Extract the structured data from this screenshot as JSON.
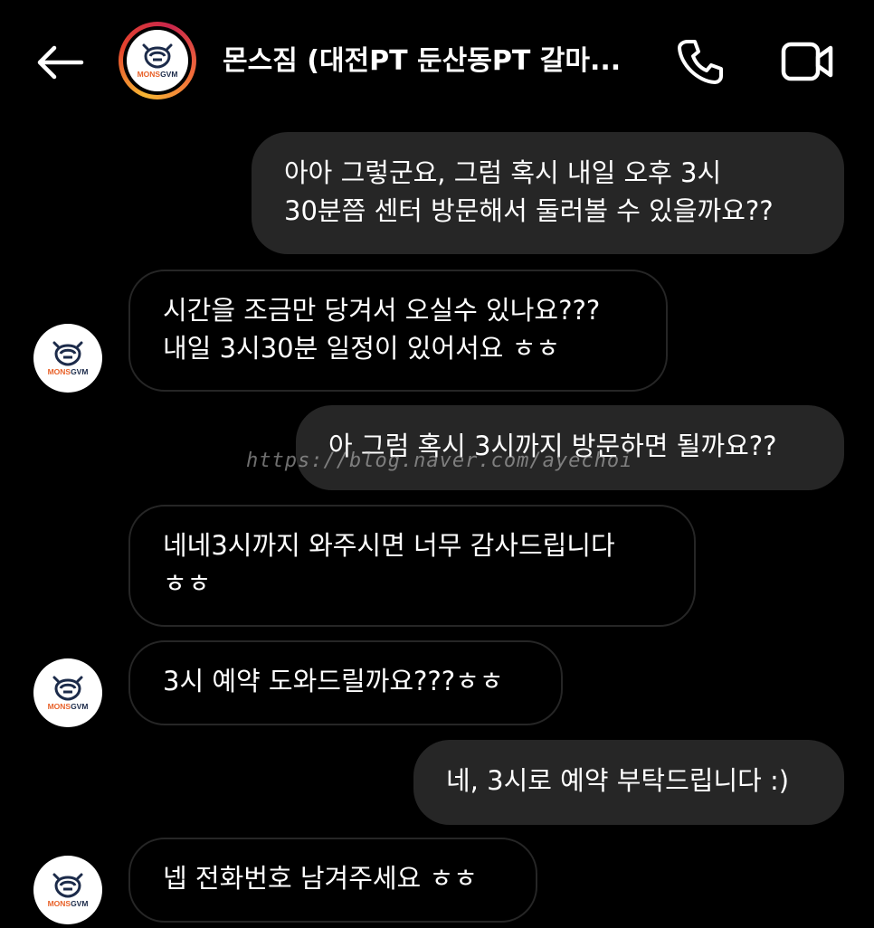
{
  "header": {
    "title": "몬스짐 (대전PT 둔산동PT 갈마...",
    "back_icon": "arrow-left-icon",
    "call_icon": "phone-icon",
    "video_icon": "video-camera-icon",
    "avatar_logo_text": "MONSGVM"
  },
  "colors": {
    "background": "#000000",
    "sent_bubble": "#262626",
    "received_border": "#262626",
    "text": "#ffffff",
    "story_ring_start": "#f7b733",
    "story_ring_end": "#c9264b",
    "logo_navy": "#1c2b4a",
    "logo_orange": "#e8622a"
  },
  "messages": [
    {
      "from": "me",
      "text": "아아 그렇군요, 그럼 혹시 내일 오후 3시\n30분쯤 센터 방문해서 둘러볼 수 있을까요??"
    },
    {
      "from": "gym",
      "text": "시간을 조금만 당겨서 오실수 있나요???\n내일 3시30분 일정이 있어서요 ㅎㅎ"
    },
    {
      "from": "me",
      "text": "아 그럼 혹시 3시까지 방문하면 될까요??"
    },
    {
      "from": "gym",
      "text": "네네3시까지 와주시면 너무 감사드립니다\nㅎㅎ"
    },
    {
      "from": "gym",
      "text": "3시 예약 도와드릴까요???ㅎㅎ"
    },
    {
      "from": "me",
      "text": "네, 3시로 예약 부탁드립니다 :)"
    },
    {
      "from": "gym",
      "text": "넵 전화번호 남겨주세요 ㅎㅎ"
    }
  ],
  "watermark": "https://blog.naver.com/ayechoi"
}
